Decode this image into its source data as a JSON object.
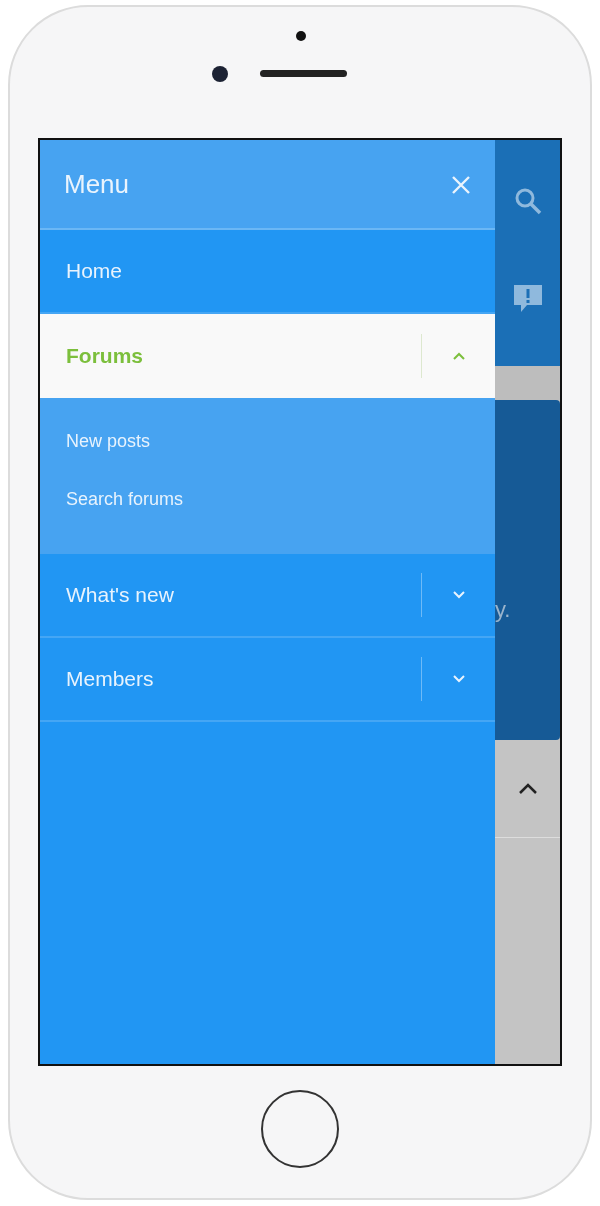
{
  "menu": {
    "title": "Menu"
  },
  "nav_items": [
    {
      "kind": "link",
      "label": "Home",
      "selected": false
    },
    {
      "kind": "group",
      "label": "Forums",
      "selected": true,
      "expanded": true,
      "children": [
        {
          "label": "New posts"
        },
        {
          "label": "Search forums"
        }
      ]
    },
    {
      "kind": "group",
      "label": "What's new",
      "selected": false,
      "expanded": false
    },
    {
      "kind": "group",
      "label": "Members",
      "selected": false,
      "expanded": false
    }
  ],
  "background_text": "y."
}
